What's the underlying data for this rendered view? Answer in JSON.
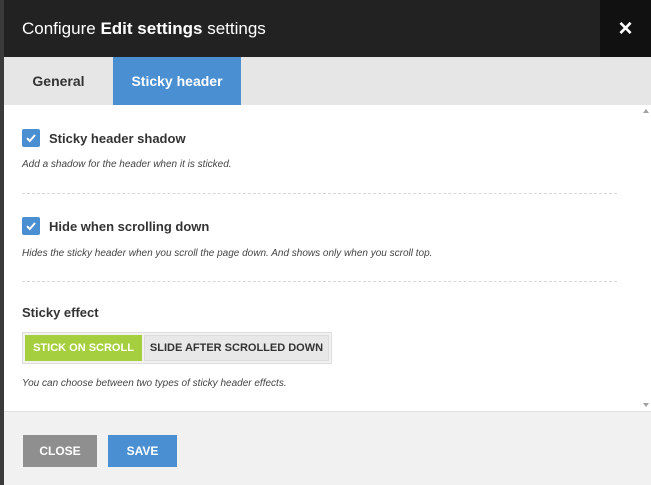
{
  "dialog": {
    "title_prefix": "Configure",
    "title_bold": "Edit settings",
    "title_suffix": "settings",
    "close_icon": "×"
  },
  "tabs": [
    {
      "label": "General",
      "active": false
    },
    {
      "label": "Sticky header",
      "active": true
    }
  ],
  "settings": {
    "shadow": {
      "label": "Sticky header shadow",
      "checked": true,
      "description": "Add a shadow for the header when it is sticked."
    },
    "hide": {
      "label": "Hide when scrolling down",
      "checked": true,
      "description": "Hides the sticky header when you scroll the page down. And shows only when you scroll top."
    },
    "effect": {
      "label": "Sticky effect",
      "options": [
        "STICK ON SCROLL",
        "SLIDE AFTER SCROLLED DOWN"
      ],
      "selected": "STICK ON SCROLL",
      "description": "You can choose between two types of sticky header effects."
    }
  },
  "footer": {
    "close_label": "CLOSE",
    "save_label": "SAVE"
  },
  "colors": {
    "accent": "#4a8fd1",
    "selected_option": "#a6cf3f",
    "titlebar": "#222222"
  }
}
